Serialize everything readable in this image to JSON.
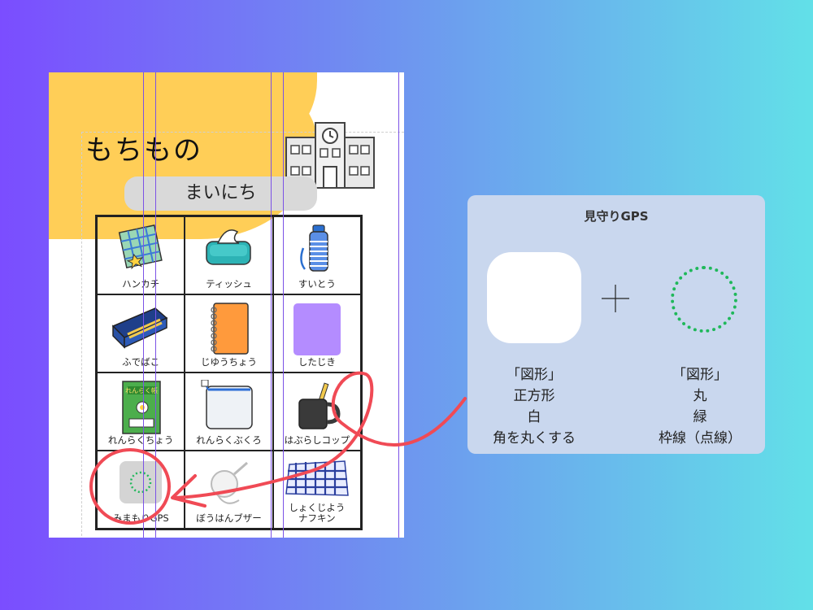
{
  "worksheet": {
    "title": "もちもの",
    "everyday_label": "まいにち",
    "items": [
      {
        "label": "ハンカチ",
        "icon": "handkerchief-icon"
      },
      {
        "label": "ティッシュ",
        "icon": "tissue-icon"
      },
      {
        "label": "すいとう",
        "icon": "water-bottle-icon"
      },
      {
        "label": "ふでばこ",
        "icon": "pencil-case-icon"
      },
      {
        "label": "じゆうちょう",
        "icon": "notebook-icon"
      },
      {
        "label": "したじき",
        "icon": "pencil-board-icon"
      },
      {
        "label": "れんらくちょう",
        "icon": "contact-book-icon"
      },
      {
        "label": "れんらくぶくろ",
        "icon": "contact-bag-icon"
      },
      {
        "label": "はぶらしコップ",
        "icon": "toothbrush-cup-icon"
      },
      {
        "label": "みまもりGPS",
        "icon": "gps-icon"
      },
      {
        "label": "ぼうはんブザー",
        "icon": "security-buzzer-icon"
      },
      {
        "label": "しょくじよう",
        "label2": "ナフキン",
        "icon": "napkin-icon"
      }
    ]
  },
  "panel": {
    "title": "見守りGPS",
    "left_desc": [
      "「図形」",
      "正方形",
      "白",
      "角を丸くする"
    ],
    "right_desc": [
      "「図形」",
      "丸",
      "緑",
      "枠線（点線）"
    ]
  },
  "colors": {
    "background_start": "#7b4dff",
    "background_end": "#62e0e8",
    "blob": "#ffce57",
    "panel": "#c9d7ee",
    "dotted_circle": "#1fb85a",
    "annotation": "#f04a55",
    "guide": "#7b52e6"
  }
}
